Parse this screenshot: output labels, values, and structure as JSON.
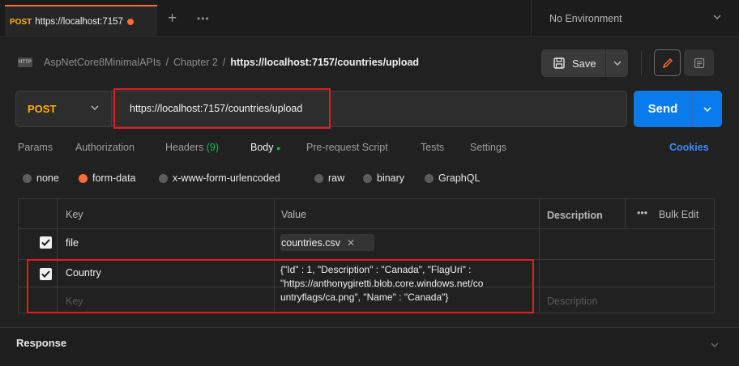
{
  "tab": {
    "method": "POST",
    "title": "https://localhost:7157"
  },
  "toolbar": {
    "more": "•••"
  },
  "environment": {
    "selected": "No Environment"
  },
  "breadcrumb": {
    "icon_text": "HTTP",
    "collection": "AspNetCore8MinimalAPIs",
    "sep1": "/",
    "folder": "Chapter 2",
    "sep2": "/",
    "current": "https://localhost:7157/countries/upload"
  },
  "save": {
    "label": "Save"
  },
  "request": {
    "method": "POST",
    "url": "https://localhost:7157/countries/upload"
  },
  "send": {
    "label": "Send"
  },
  "tabs": {
    "params": "Params",
    "authorization": "Authorization",
    "headers": "Headers",
    "headers_count": "(9)",
    "body": "Body",
    "body_dot": "●",
    "prerequest": "Pre-request Script",
    "tests": "Tests",
    "settings": "Settings",
    "cookies": "Cookies"
  },
  "body_options": {
    "none": "none",
    "form_data": "form-data",
    "urlencoded": "x-www-form-urlencoded",
    "raw": "raw",
    "binary": "binary",
    "graphql": "GraphQL",
    "selected": "form-data"
  },
  "table": {
    "headers": {
      "key": "Key",
      "value": "Value",
      "description": "Description",
      "more": "•••",
      "bulk_edit": "Bulk Edit"
    },
    "rows": [
      {
        "key": "file",
        "value": "countries.csv",
        "checked": true
      },
      {
        "key": "Country",
        "value": "{\"Id\" : 1, \"Description\" : \"Canada\", \"FlagUri\" : \"https://anthonygiretti.blob.core.windows.net/countryflags/ca.png\", \"Name\" : \"Canada\"}",
        "value_lines": [
          "{\"Id\" : 1, \"Description\" : \"Canada\", \"FlagUri\" :",
          "\"https://anthonygiretti.blob.core.windows.net/co",
          "untryflags/ca.png\", \"Name\" : \"Canada\"}"
        ],
        "checked": true
      }
    ],
    "placeholder": {
      "key": "Key",
      "description": "Description"
    }
  },
  "response": {
    "label": "Response"
  },
  "colors": {
    "accent": "#ff6c37",
    "send": "#097bed",
    "method": "#ffb400",
    "highlight_box": "#e31c24",
    "link": "#3a8ef5"
  }
}
